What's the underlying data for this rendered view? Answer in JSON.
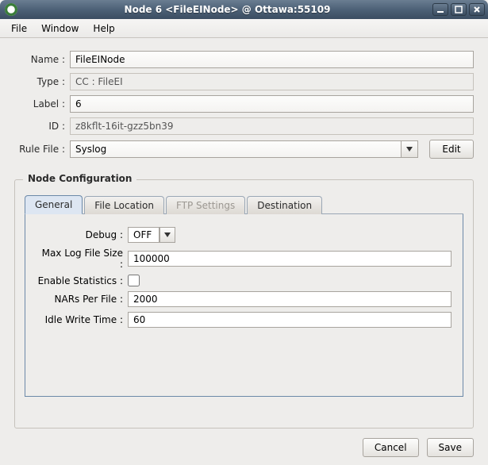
{
  "titlebar": {
    "title": "Node 6 <FileEINode> @ Ottawa:55109"
  },
  "menubar": {
    "file": "File",
    "window": "Window",
    "help": "Help"
  },
  "form": {
    "name_label": "Name :",
    "name_value": "FileEINode",
    "type_label": "Type :",
    "type_value": "CC : FileEI",
    "label_label": "Label :",
    "label_value": "6",
    "id_label": "ID :",
    "id_value": "z8kflt-16it-gzz5bn39",
    "rule_label": "Rule File :",
    "rule_value": "Syslog",
    "edit_btn": "Edit"
  },
  "group": {
    "title": "Node Configuration"
  },
  "tabs": {
    "general": "General",
    "file_location": "File Location",
    "ftp_settings": "FTP Settings",
    "destination": "Destination"
  },
  "general_tab": {
    "debug_label": "Debug :",
    "debug_value": "OFF",
    "maxlog_label": "Max Log File Size :",
    "maxlog_value": "100000",
    "enable_stats_label": "Enable Statistics :",
    "enable_stats_checked": false,
    "nars_label": "NARs Per File :",
    "nars_value": "2000",
    "idle_label": "Idle Write Time :",
    "idle_value": "60"
  },
  "footer": {
    "cancel": "Cancel",
    "save": "Save"
  }
}
